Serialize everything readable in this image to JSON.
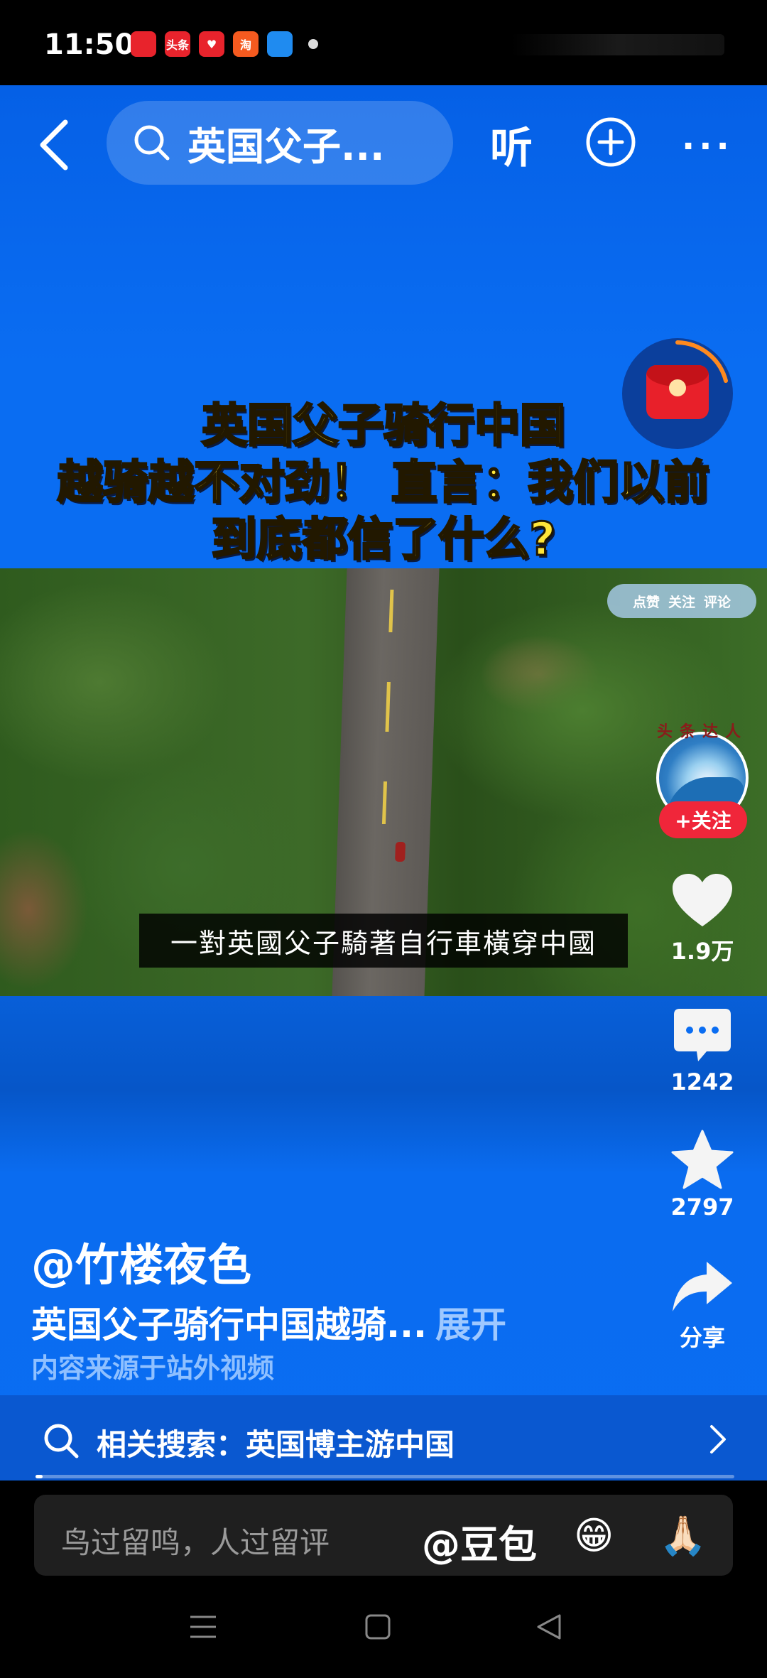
{
  "status_bar": {
    "time": "11:50",
    "apps": [
      {
        "label": "",
        "color": "#e8232c"
      },
      {
        "label": "头条",
        "color": "#e8232c"
      },
      {
        "label": "♥",
        "color": "#e8232c"
      },
      {
        "label": "淘",
        "color": "#f55a1f"
      },
      {
        "label": "",
        "color": "#1f8bf0"
      }
    ]
  },
  "header": {
    "search_text": "英国父子...",
    "listen_label": "听",
    "more_label": "···",
    "back_icon": "chevron-left-icon",
    "plus_icon": "plus-circle-icon"
  },
  "video": {
    "title_lines": [
      "英国父子骑行中国",
      "越骑越不对劲！ 直言：我们以前",
      "到底都信了什么?"
    ],
    "tag": {
      "items": [
        "点赞",
        "关注",
        "评论"
      ]
    },
    "subtitle": "一對英國父子騎著自行車橫穿中國"
  },
  "creator": {
    "badge_text": "头条达人",
    "follow_label": "+关注"
  },
  "actions": {
    "like_count": "1.9万",
    "comment_count": "1242",
    "favorite_count": "2797",
    "share_label": "分享"
  },
  "post": {
    "author": "@竹楼夜色",
    "description": "英国父子骑行中国越骑...",
    "expand_label": "展开",
    "source": "内容来源于站外视频"
  },
  "related": {
    "text": "相关搜索：英国博主游中国"
  },
  "progress": {
    "fraction": 0.01
  },
  "comment_bar": {
    "placeholder": "鸟过留鸣，人过留评",
    "mention": "@豆包",
    "emojis": [
      "😁",
      "🙏🏻"
    ]
  },
  "colors": {
    "accent_blue": "#0a6df2",
    "title_yellow": "#ffe63a",
    "follow_red": "#f0263a"
  }
}
